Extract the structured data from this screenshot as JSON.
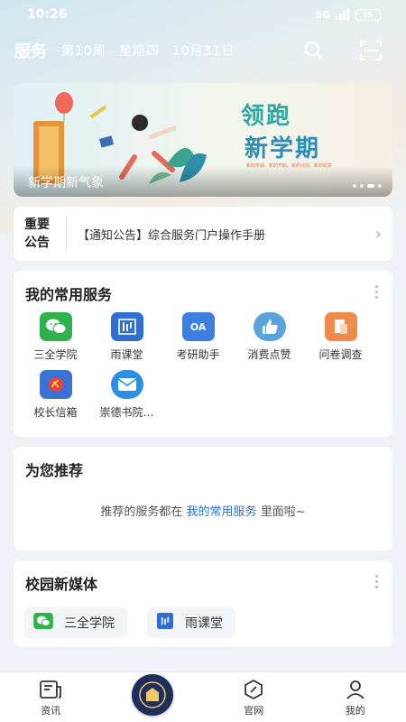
{
  "status_bar": {
    "time": "10:26",
    "network": "5G",
    "battery": "95"
  },
  "header": {
    "title": "服务",
    "week": "第10周",
    "weekday": "星期四",
    "date": "10月31日"
  },
  "banner": {
    "caption": "新学期新气象",
    "slogan_line1": "领跑",
    "slogan_line2": "新学期",
    "tagline": "新的学期、新的开始、新的计划、新的收获"
  },
  "notice": {
    "tag": "重要公告",
    "text": "【通知公告】综合服务门户操作手册"
  },
  "common_services": {
    "title": "我的常用服务",
    "items": [
      {
        "label": "三全学院",
        "icon": "wechat-icon",
        "color": "#2eb24c"
      },
      {
        "label": "雨课堂",
        "icon": "rain-classroom-icon",
        "color": "#2f6fd1"
      },
      {
        "label": "考研助手",
        "icon": "oa-icon",
        "color": "#3d7fe0"
      },
      {
        "label": "消费点赞",
        "icon": "thumbs-up-icon",
        "color": "#5aa3dc"
      },
      {
        "label": "问卷调查",
        "icon": "survey-icon",
        "color": "#f08a4b"
      },
      {
        "label": "校长信箱",
        "icon": "party-emblem-icon",
        "color": "#3a73d6"
      },
      {
        "label": "崇德书院…",
        "icon": "mail-icon",
        "color": "#2d8ee6"
      }
    ]
  },
  "recommend": {
    "title": "为您推荐",
    "text_before": "推荐的服务都在",
    "link": "我的常用服务",
    "text_after": "里面啦~"
  },
  "media": {
    "title": "校园新媒体",
    "items": [
      {
        "label": "三全学院",
        "icon": "wechat-icon"
      },
      {
        "label": "雨课堂",
        "icon": "rain-classroom-icon"
      }
    ]
  },
  "tabbar": {
    "items": [
      {
        "label": "资讯",
        "icon": "news-icon"
      },
      {
        "label": "",
        "icon": "school-emblem-icon"
      },
      {
        "label": "官网",
        "icon": "compass-icon"
      },
      {
        "label": "我的",
        "icon": "profile-icon"
      }
    ]
  },
  "colors": {
    "accent": "#2a6fd6",
    "background": "#eef2f6"
  }
}
